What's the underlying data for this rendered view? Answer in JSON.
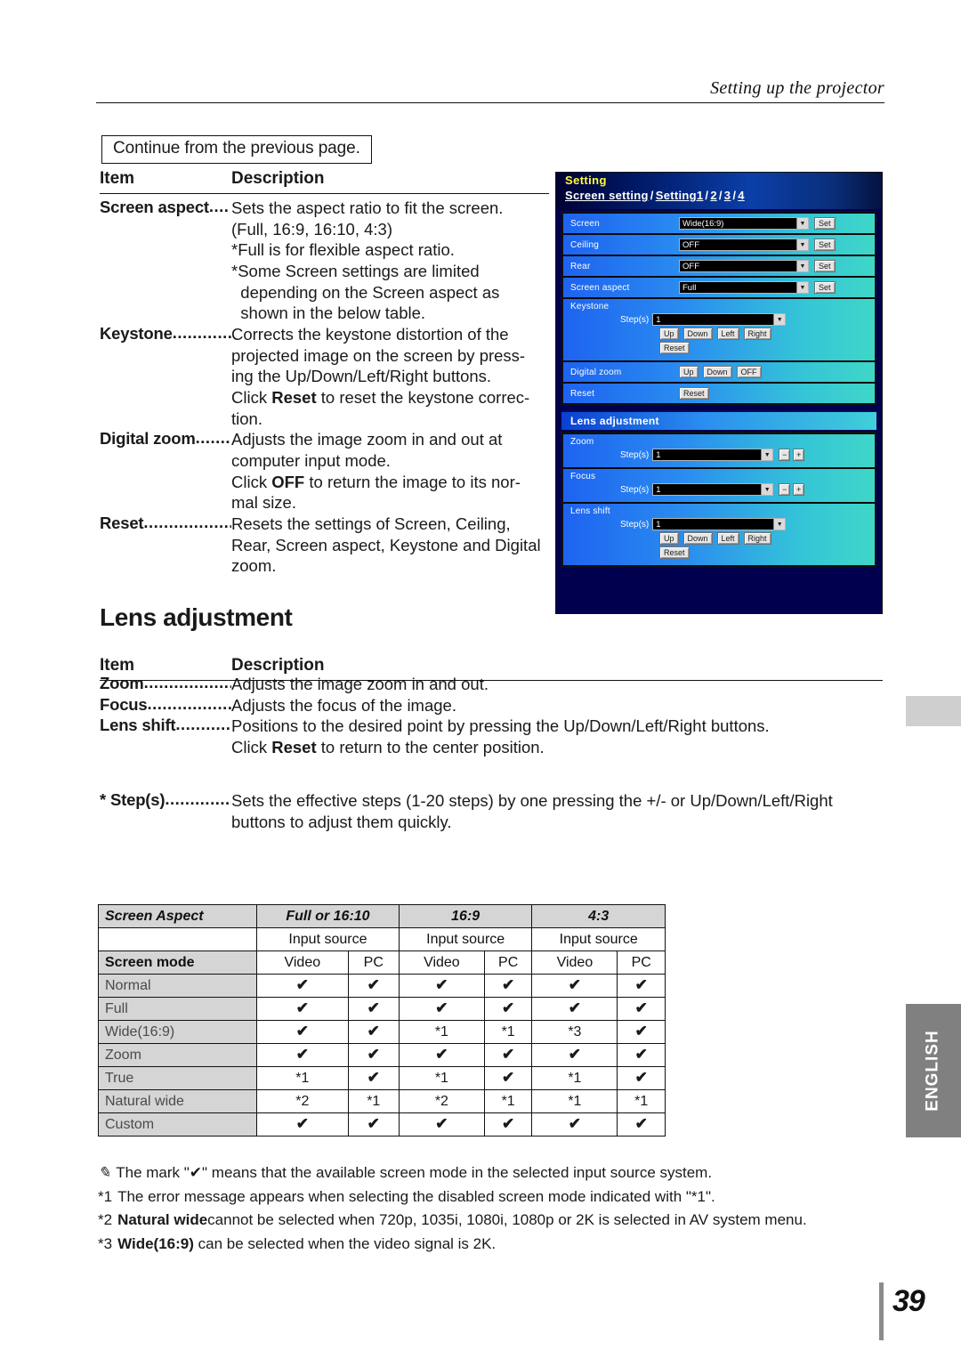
{
  "header": {
    "title": "Setting up the projector"
  },
  "continue_box": {
    "label": "Continue from the previous page."
  },
  "table_heading": {
    "item": "Item",
    "description": "Description"
  },
  "screen_setting_items": [
    {
      "term": "Screen aspect",
      "dots": "....",
      "lines": [
        "Sets the aspect ratio to fit the screen.",
        "(Full, 16:9, 16:10, 4:3)",
        "*Full is for flexible aspect ratio.",
        "*Some Screen settings are limited",
        "  depending on the Screen aspect as",
        "  shown in the below table."
      ]
    },
    {
      "term": "Keystone",
      "dots": "...............",
      "lines": [
        "Corrects the keystone distortion of the",
        "projected image on the screen by press-",
        "ing the Up/Down/Left/Right buttons.",
        "Click Reset to reset the keystone correc-",
        "tion."
      ],
      "bold_words": [
        "Reset"
      ]
    },
    {
      "term": "Digital zoom",
      "dots": ".......",
      "lines": [
        "Adjusts the image zoom in and out at",
        "computer input mode.",
        "Click OFF to return the image to its nor-",
        "mal size."
      ],
      "bold_words": [
        "OFF"
      ]
    },
    {
      "term": "Reset",
      "dots": "........................",
      "lines": [
        "Resets the settings of Screen, Ceiling,",
        "Rear, Screen aspect, Keystone and Digital",
        "zoom."
      ]
    }
  ],
  "lens_section": {
    "title": "Lens adjustment",
    "table_heading": {
      "item": "Item",
      "description": "Description"
    },
    "items": [
      {
        "term": "Zoom",
        "dots": ".....................",
        "lines": [
          "Adjusts the image zoom in and out."
        ]
      },
      {
        "term": "Focus",
        "dots": "......................",
        "lines": [
          "Adjusts the focus of the image."
        ]
      },
      {
        "term": "Lens shift",
        "dots": "..............",
        "lines": [
          "Positions to the desired point by pressing the Up/Down/Left/Right buttons.",
          "Click Reset to return to the center position."
        ],
        "bold_words": [
          "Reset"
        ]
      }
    ]
  },
  "steps_note": {
    "star": "*",
    "term": "Step(s)",
    "dots": "................",
    "lines": [
      "Sets the effective steps (1-20 steps) by one pressing the +/- or Up/Down/Left/Right",
      "buttons to adjust them quickly."
    ]
  },
  "projector_ui": {
    "title": "Setting",
    "breadcrumb": {
      "current": "Screen setting",
      "links": [
        "Setting1",
        "2",
        "3",
        "4"
      ],
      "separator": "/"
    },
    "rows": [
      {
        "label": "Screen",
        "value": "Wide(16:9)",
        "button": "Set"
      },
      {
        "label": "Ceiling",
        "value": "OFF",
        "button": "Set"
      },
      {
        "label": "Rear",
        "value": "OFF",
        "button": "Set"
      },
      {
        "label": "Screen aspect",
        "value": "Full",
        "button": "Set"
      }
    ],
    "keystone": {
      "label": "Keystone",
      "steps_label": "Step(s)",
      "steps_value": "1",
      "direction_buttons": [
        "Up",
        "Down",
        "Left",
        "Right"
      ],
      "reset_button": "Reset"
    },
    "digital_zoom": {
      "label": "Digital zoom",
      "buttons": [
        "Up",
        "Down",
        "OFF"
      ]
    },
    "reset_row": {
      "label": "Reset",
      "button": "Reset"
    },
    "lens_adjustment": {
      "title": "Lens adjustment",
      "zoom": {
        "label": "Zoom",
        "steps_label": "Step(s)",
        "steps_value": "1",
        "minus": "−",
        "plus": "+"
      },
      "focus": {
        "label": "Focus",
        "steps_label": "Step(s)",
        "steps_value": "1",
        "minus": "−",
        "plus": "+"
      },
      "lens_shift": {
        "label": "Lens shift",
        "steps_label": "Step(s)",
        "steps_value": "1",
        "direction_buttons": [
          "Up",
          "Down",
          "Left",
          "Right"
        ],
        "reset_button": "Reset"
      }
    }
  },
  "aspect_table": {
    "corner": "Screen Aspect",
    "aspect_groups": [
      "Full or 16:10",
      "16:9",
      "4:3"
    ],
    "input_source_label": "Input source",
    "screen_mode_label": "Screen mode",
    "source_columns": [
      "Video",
      "PC",
      "Video",
      "PC",
      "Video",
      "PC"
    ],
    "rows": [
      {
        "mode": "Normal",
        "cells": [
          "✔",
          "✔",
          "✔",
          "✔",
          "✔",
          "✔"
        ]
      },
      {
        "mode": "Full",
        "cells": [
          "✔",
          "✔",
          "✔",
          "✔",
          "✔",
          "✔"
        ]
      },
      {
        "mode": "Wide(16:9)",
        "cells": [
          "✔",
          "✔",
          "*1",
          "*1",
          "*3",
          "✔"
        ]
      },
      {
        "mode": "Zoom",
        "cells": [
          "✔",
          "✔",
          "✔",
          "✔",
          "✔",
          "✔"
        ]
      },
      {
        "mode": "True",
        "cells": [
          "*1",
          "✔",
          "*1",
          "✔",
          "*1",
          "✔"
        ]
      },
      {
        "mode": "Natural wide",
        "cells": [
          "*2",
          "*1",
          "*2",
          "*1",
          "*1",
          "*1"
        ]
      },
      {
        "mode": "Custom",
        "cells": [
          "✔",
          "✔",
          "✔",
          "✔",
          "✔",
          "✔"
        ]
      }
    ]
  },
  "footnotes": [
    {
      "mark": "✎",
      "text": "The mark \"✔\" means that the available screen mode in the selected input source system."
    },
    {
      "mark": "*1",
      "text": "The error message appears when selecting the disabled screen mode indicated with \"*1\"."
    },
    {
      "mark": "*2",
      "text": "Natural widecannot be selected when 720p, 1035i, 1080i, 1080p or 2K is selected in AV system menu.",
      "bold_words": [
        "Natural wide"
      ]
    },
    {
      "mark": "*3",
      "text": "Wide(16:9) can be selected when the video signal is 2K.",
      "bold_words": [
        "Wide(16:9)"
      ]
    }
  ],
  "side_tab": {
    "language": "ENGLISH"
  },
  "page_number": "39"
}
